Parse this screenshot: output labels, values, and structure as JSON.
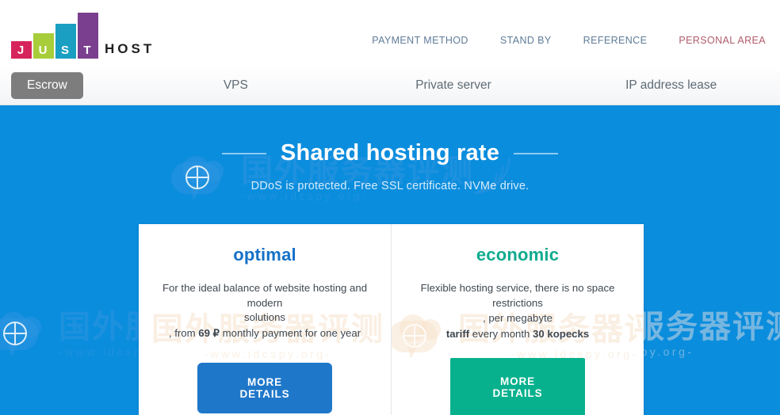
{
  "brand": {
    "name_letters": [
      "J",
      "U",
      "S",
      "T"
    ],
    "name_suffix": "HOST",
    "bar_colors": [
      "#d6255c",
      "#a8cd3a",
      "#1a9fc2",
      "#7b3f8f"
    ]
  },
  "top_nav": {
    "items": [
      {
        "label": "PAYMENT METHOD",
        "accent": false
      },
      {
        "label": "STAND BY",
        "accent": false
      },
      {
        "label": "REFERENCE",
        "accent": false
      },
      {
        "label": "PERSONAL AREA",
        "accent": true
      }
    ],
    "accent_color": "#b05c6c",
    "link_color": "#5f7c99"
  },
  "sub_nav": {
    "tabs": [
      {
        "label": "Escrow",
        "active": true
      },
      {
        "label": "VPS",
        "active": false
      },
      {
        "label": "Private server",
        "active": false
      },
      {
        "label": "IP address lease",
        "active": false
      }
    ],
    "active_background": "#7d7d7d"
  },
  "hero": {
    "title": "Shared hosting rate",
    "subtitle": "DDoS is protected. Free SSL certificate. NVMe drive.",
    "background_color": "#0b8ddd"
  },
  "plans": [
    {
      "title": "optimal",
      "title_color": "#1771c6",
      "desc_line1": "For the ideal balance of website hosting and modern",
      "desc_line2": "solutions",
      "price_prefix": ", from ",
      "price_value": "69 ₽",
      "price_suffix": " monthly payment for one year",
      "button_label": "MORE DETAILS",
      "button_color": "#1f77c9"
    },
    {
      "title": "economic",
      "title_color": "#11ab8e",
      "desc_line1": "Flexible hosting service, there is no space",
      "desc_line2": "restrictions",
      "desc_line3": ", per megabyte",
      "tariff_word": "tariff",
      "tariff_mid": " every month ",
      "tariff_value": "30 kopecks",
      "button_label": "MORE DETAILS",
      "button_color": "#08b18d"
    }
  ],
  "watermark": {
    "cn_text": "国外服务器评测",
    "url_text": "-www.idcspy.org-"
  }
}
